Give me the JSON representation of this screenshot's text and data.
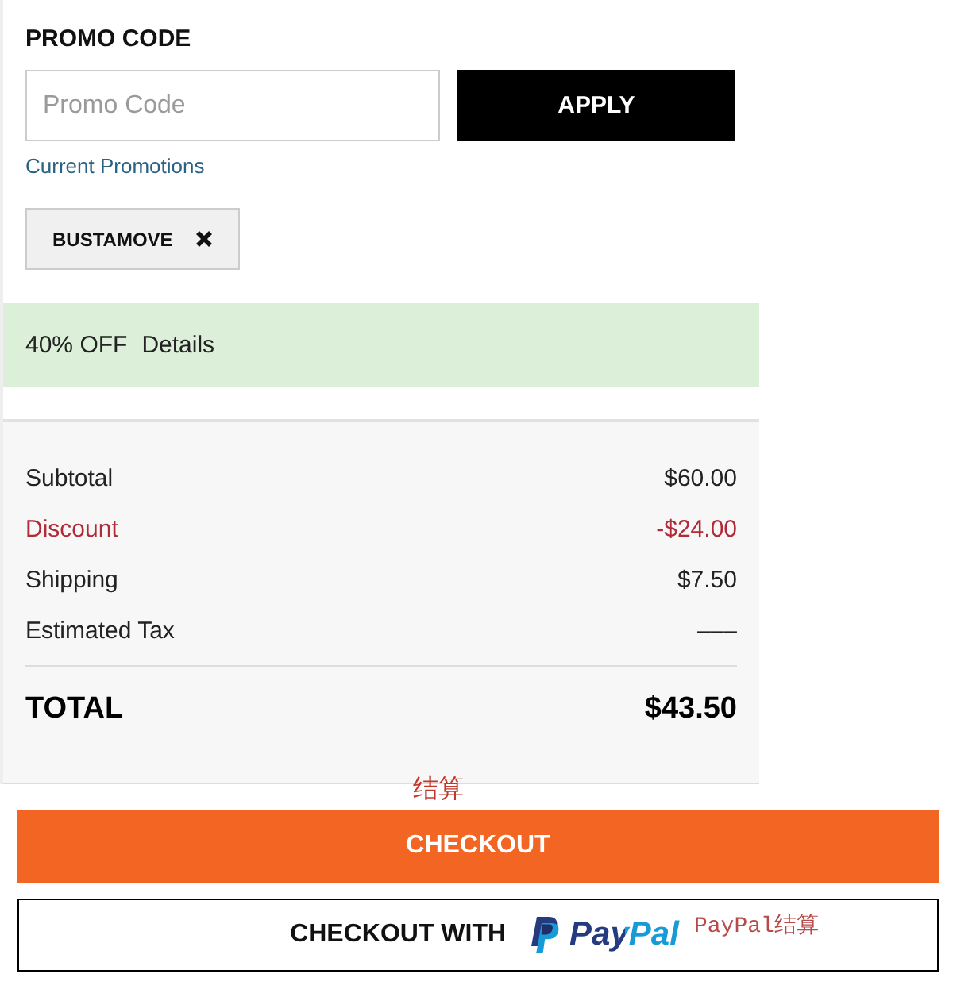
{
  "promo": {
    "heading": "PROMO CODE",
    "input": {
      "placeholder": "Promo Code"
    },
    "apply_button": "APPLY",
    "link": "Current Promotions",
    "applied_codes": [
      {
        "code": "BUSTAMOVE"
      }
    ]
  },
  "offer": {
    "label": "40% OFF",
    "details_link": "Details"
  },
  "summary": {
    "rows": [
      {
        "label": "Subtotal",
        "value": "$60.00",
        "kind": "line"
      },
      {
        "label": "Discount",
        "value": "-$24.00",
        "kind": "discount"
      },
      {
        "label": "Shipping",
        "value": "$7.50",
        "kind": "line"
      },
      {
        "label": "Estimated Tax",
        "value": "–––",
        "kind": "line"
      }
    ],
    "total": {
      "label": "TOTAL",
      "value": "$43.50"
    }
  },
  "checkout": {
    "button": "CHECKOUT",
    "annotation": "结算"
  },
  "paypal": {
    "label": "CHECKOUT WITH",
    "logo_text": "PayPal",
    "annotation": "PayPal结算"
  }
}
